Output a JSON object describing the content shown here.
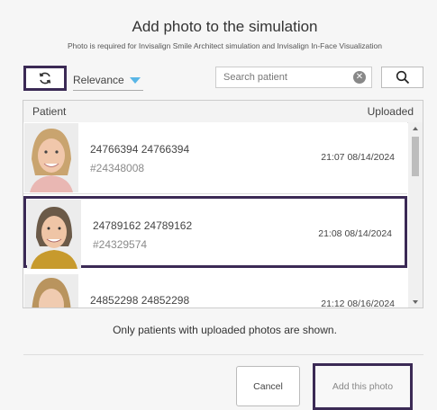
{
  "dialog": {
    "title": "Add photo to the simulation",
    "subtitle": "Photo is required for Invisalign Smile Architect simulation and Invisalign In-Face Visualization"
  },
  "toolbar": {
    "refresh_icon": "refresh-icon",
    "sort_label": "Relevance",
    "search_placeholder": "Search patient",
    "search_icon": "search-icon",
    "clear_icon": "clear-icon"
  },
  "table": {
    "headers": {
      "patient": "Patient",
      "uploaded": "Uploaded"
    },
    "rows": [
      {
        "name": "24766394 24766394",
        "id": "#24348008",
        "uploaded": "21:07 08/14/2024",
        "selected": false
      },
      {
        "name": "24789162 24789162",
        "id": "#24329574",
        "uploaded": "21:08 08/14/2024",
        "selected": true
      },
      {
        "name": "24852298 24852298",
        "id": "",
        "uploaded": "21:12 08/16/2024",
        "selected": false
      }
    ]
  },
  "note": "Only patients with uploaded photos are shown.",
  "buttons": {
    "cancel": "Cancel",
    "add": "Add this photo"
  },
  "colors": {
    "highlight": "#3b2a55",
    "accent": "#59b6e6"
  }
}
